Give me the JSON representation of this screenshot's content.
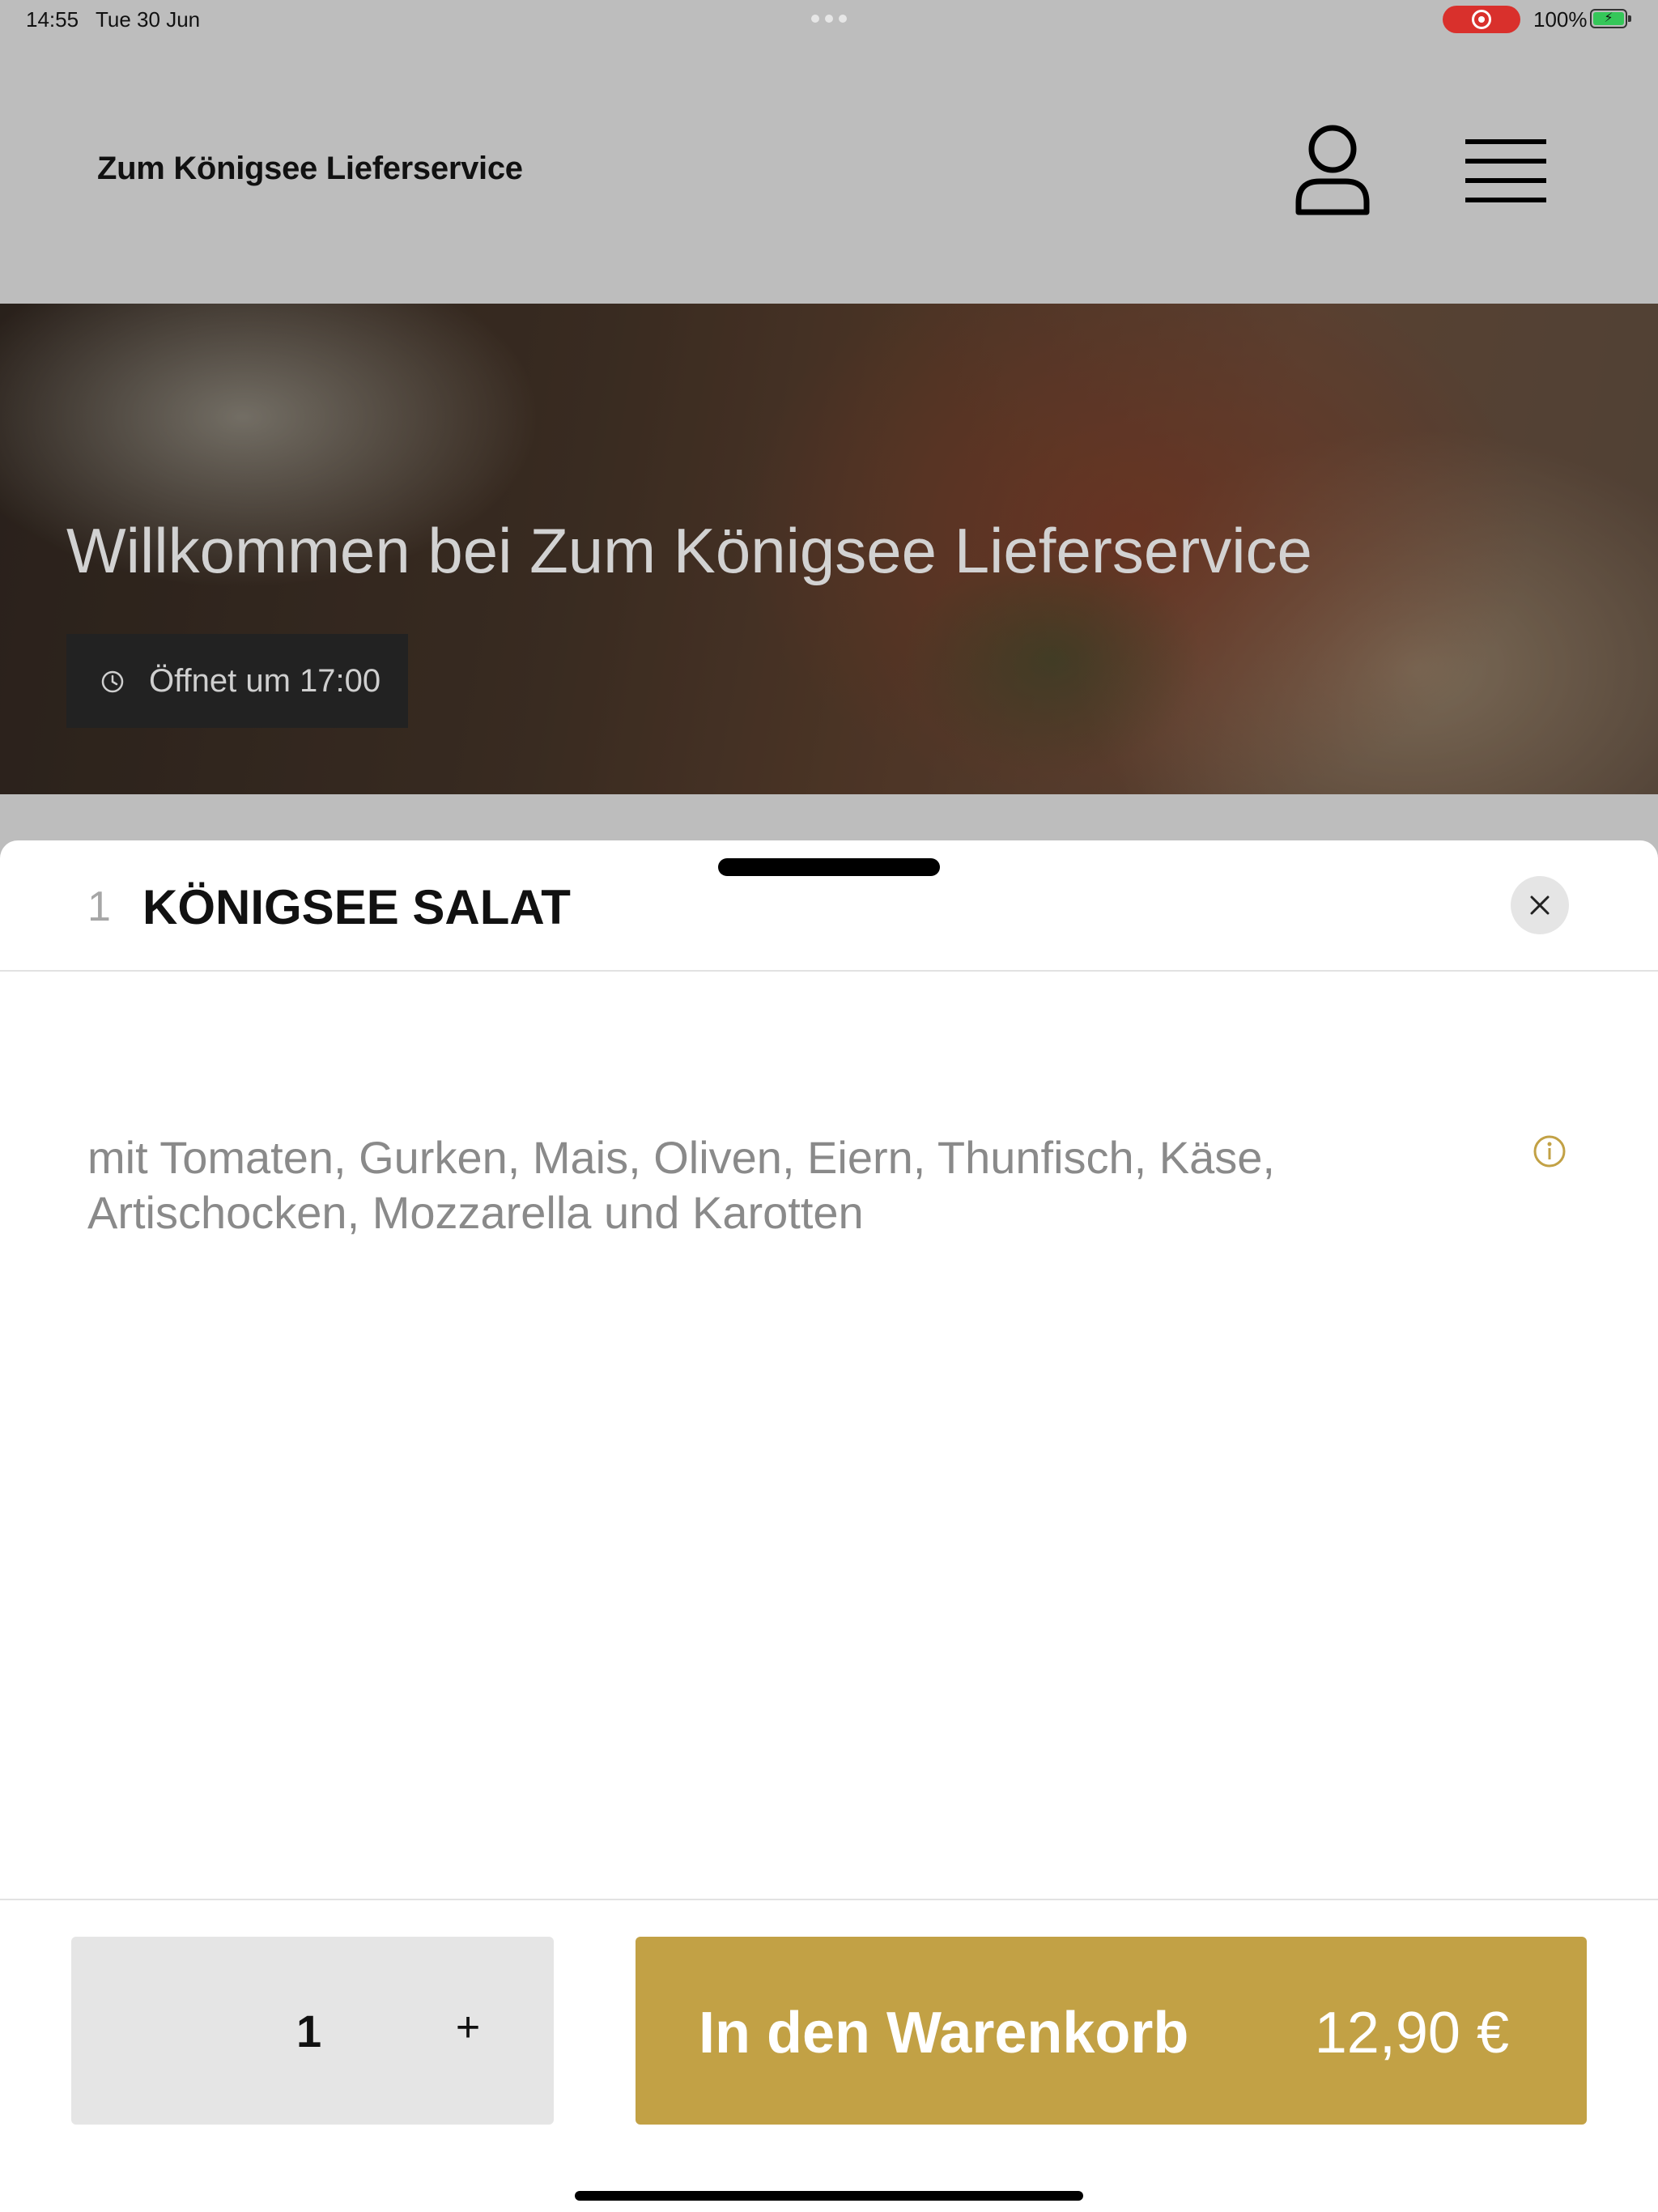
{
  "status_bar": {
    "time": "14:55",
    "date": "Tue 30 Jun",
    "battery": "100%",
    "recording_color": "#d9302c"
  },
  "header": {
    "title": "Zum Königsee Lieferservice",
    "account_icon": "user-icon",
    "menu_icon": "hamburger-menu-icon"
  },
  "hero": {
    "title": "Willkommen bei Zum Königsee Lieferservice",
    "hours": "Öffnet um 17:00",
    "hours_icon": "clock-icon"
  },
  "item": {
    "number": "1",
    "name": "KÖNIGSEE SALAT",
    "description": "mit Tomaten, Gurken, Mais, Oliven, Eiern, Thunfisch, Käse, Artischocken, Mozzarella und Karotten",
    "info_icon": "info-icon",
    "close_icon": "close-icon"
  },
  "footer": {
    "quantity": "1",
    "plus_label": "+",
    "cart_label": "In den Warenkorb",
    "price": "12,90 €",
    "accent_color": "#c2a145"
  }
}
